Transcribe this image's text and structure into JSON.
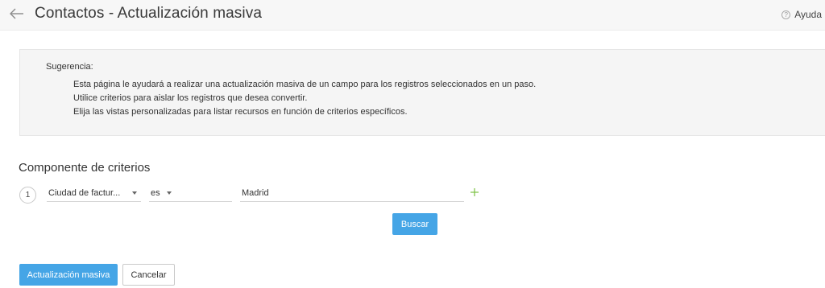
{
  "header": {
    "title": "Contactos - Actualización masiva",
    "help_label": "Ayuda",
    "help_icon_glyph": "?"
  },
  "tip": {
    "label": "Sugerencia:",
    "lines": [
      "Esta página le ayudará a realizar una actualización masiva de un campo para los registros seleccionados en un paso.",
      "Utilice criterios para aislar los registros que desea convertir.",
      "Elija las vistas personalizadas para listar recursos en función de criterios específicos."
    ]
  },
  "criteria": {
    "title": "Componente de criterios",
    "rows": [
      {
        "index": "1",
        "field": "Ciudad de factur...",
        "operator": "es",
        "value": "Madrid"
      }
    ],
    "search_label": "Buscar"
  },
  "footer": {
    "mass_update_label": "Actualización masiva",
    "cancel_label": "Cancelar"
  },
  "icons": {
    "back": "back-arrow-icon",
    "help": "help-icon",
    "add": "plus-icon",
    "dropdown": "caret-down-icon"
  },
  "colors": {
    "primary": "#45a5e6",
    "add_icon": "#7ac043",
    "tip_background": "#f5f5f5",
    "header_background": "#f7f7f7"
  }
}
